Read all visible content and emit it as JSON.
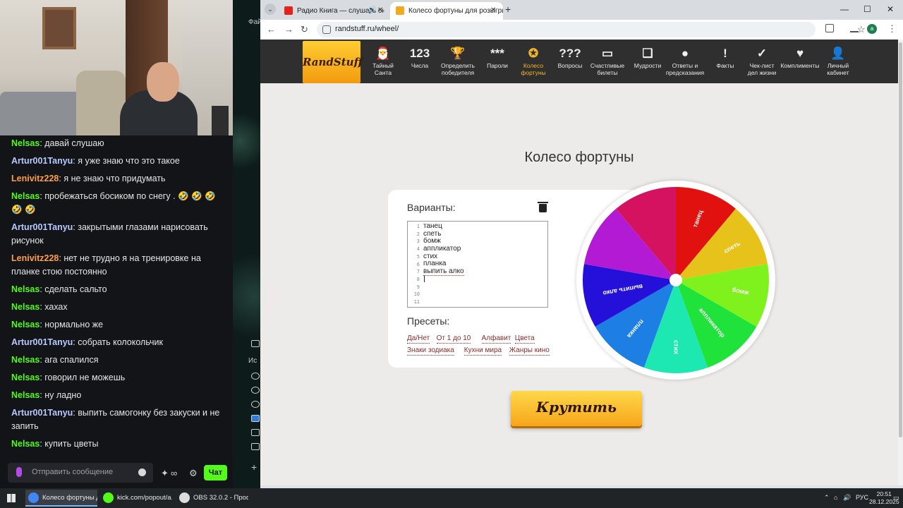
{
  "chat": {
    "messages": [
      {
        "user": "Nelsas",
        "color": "#53fc18",
        "text": "давай слушаю"
      },
      {
        "user": "Artur001Tanyu",
        "color": "#b7c9ff",
        "text": "я уже знаю что это такое"
      },
      {
        "user": "Lenivitz228",
        "color": "#ff9f45",
        "text": "я не знаю что придумать"
      },
      {
        "user": "Nelsas",
        "color": "#53fc18",
        "text": "пробежаться босиком по снегу . 🤣 🤣 🤣 🤣 🤣"
      },
      {
        "user": "Artur001Tanyu",
        "color": "#b7c9ff",
        "text": "закрытыми глазами нарисовать рисунок"
      },
      {
        "user": "Lenivitz228",
        "color": "#ff9f45",
        "text": "нет не трудно я на тренировке на планке стою постоянно"
      },
      {
        "user": "Nelsas",
        "color": "#53fc18",
        "text": "сделать сальто"
      },
      {
        "user": "Nelsas",
        "color": "#53fc18",
        "text": "хахах"
      },
      {
        "user": "Nelsas",
        "color": "#53fc18",
        "text": "нормально же"
      },
      {
        "user": "Artur001Tanyu",
        "color": "#b7c9ff",
        "text": "собрать колокольчик"
      },
      {
        "user": "Nelsas",
        "color": "#53fc18",
        "text": "ага спалился"
      },
      {
        "user": "Nelsas",
        "color": "#53fc18",
        "text": "говорил не можешь"
      },
      {
        "user": "Nelsas",
        "color": "#53fc18",
        "text": "ну ладно"
      },
      {
        "user": "Artur001Tanyu",
        "color": "#b7c9ff",
        "text": "выпить самогонку без закуски и не запить"
      },
      {
        "user": "Nelsas",
        "color": "#53fc18",
        "text": "купить цветы"
      }
    ],
    "input_placeholder": "Отправить сообщение",
    "send_label": "Чат"
  },
  "obs": {
    "label_top": "Фай",
    "label_side": "Ис"
  },
  "browser": {
    "tabs": [
      {
        "title": "Радио Книга — слушать он",
        "favicon_color": "#e62117"
      },
      {
        "title": "Колесо фортуны для розыгрыш",
        "favicon_color": "#f2a91c"
      }
    ],
    "url": "randstuff.ru/wheel/",
    "profile_initial": "a"
  },
  "site": {
    "logo": "RandStuff",
    "nav": [
      {
        "icon": "santa-icon",
        "glyph": "🎅",
        "label_lines": [
          "Тайный",
          "Санта"
        ]
      },
      {
        "icon": "numbers-icon",
        "glyph": "123",
        "label_lines": [
          "Числа"
        ]
      },
      {
        "icon": "trophy-icon",
        "glyph": "🏆",
        "label_lines": [
          "Определить",
          "победителя"
        ]
      },
      {
        "icon": "password-icon",
        "glyph": "***",
        "label_lines": [
          "Пароли"
        ]
      },
      {
        "icon": "wheel-icon",
        "glyph": "✪",
        "label_lines": [
          "Колесо",
          "фортуны"
        ],
        "active": true
      },
      {
        "icon": "questions-icon",
        "glyph": "??? ",
        "label_lines": [
          "Вопросы"
        ]
      },
      {
        "icon": "ticket-icon",
        "glyph": "▭",
        "label_lines": [
          "Счастливые",
          "билеты"
        ]
      },
      {
        "icon": "book-icon",
        "glyph": "❑",
        "label_lines": [
          "Мудрости"
        ]
      },
      {
        "icon": "eight-ball-icon",
        "glyph": "●",
        "label_lines": [
          "Ответы и",
          "предсказания"
        ]
      },
      {
        "icon": "facts-icon",
        "glyph": "!",
        "label_lines": [
          "Факты"
        ]
      },
      {
        "icon": "checklist-icon",
        "glyph": "✓",
        "label_lines": [
          "Чек-лист",
          "дел жизни"
        ]
      },
      {
        "icon": "heart-icon",
        "glyph": "♥",
        "label_lines": [
          "Комплименты"
        ]
      },
      {
        "icon": "user-icon",
        "glyph": "👤",
        "label_lines": [
          "Личный",
          "кабинет"
        ]
      }
    ],
    "title": "Колесо фортуны",
    "variants_label": "Варианты:",
    "presets_label": "Пресеты:",
    "variants": [
      "танец",
      "спеть",
      "бомж",
      "аппликатор",
      "стих",
      "планка",
      "выпить алко"
    ],
    "line_count": 11,
    "presets_row1": [
      "Да/Нет",
      "От 1 до 10",
      "Алфавит",
      "Цвета"
    ],
    "presets_row2": [
      "Знаки зодиака",
      "Кухни мира",
      "Жанры кино"
    ],
    "wheel_segments": [
      {
        "label": "танец",
        "color": "#e0110e"
      },
      {
        "label": "спеть",
        "color": "#e6c21a"
      },
      {
        "label": "бомж",
        "color": "#7ff21d"
      },
      {
        "label": "аппликатор",
        "color": "#1fe33a"
      },
      {
        "label": "стих",
        "color": "#1ee8b2"
      },
      {
        "label": "планка",
        "color": "#1d7fe3"
      },
      {
        "label": "выпить алко",
        "color": "#2410d8"
      },
      {
        "label": "",
        "color": "#b31ad3"
      },
      {
        "label": "",
        "color": "#d4125f"
      }
    ],
    "spin_label": "Крутить"
  },
  "taskbar": {
    "tasks": [
      {
        "title": "Колесо фортуны д...",
        "color": "#4285f4",
        "active": true
      },
      {
        "title": "kick.com/popout/a...",
        "color": "#53fc18",
        "active": false
      },
      {
        "title": "OBS 32.0.2 - Проф...",
        "color": "#dddddd",
        "active": false
      }
    ],
    "lang": "РУС",
    "time": "20:51",
    "date": "28.12.2025"
  }
}
